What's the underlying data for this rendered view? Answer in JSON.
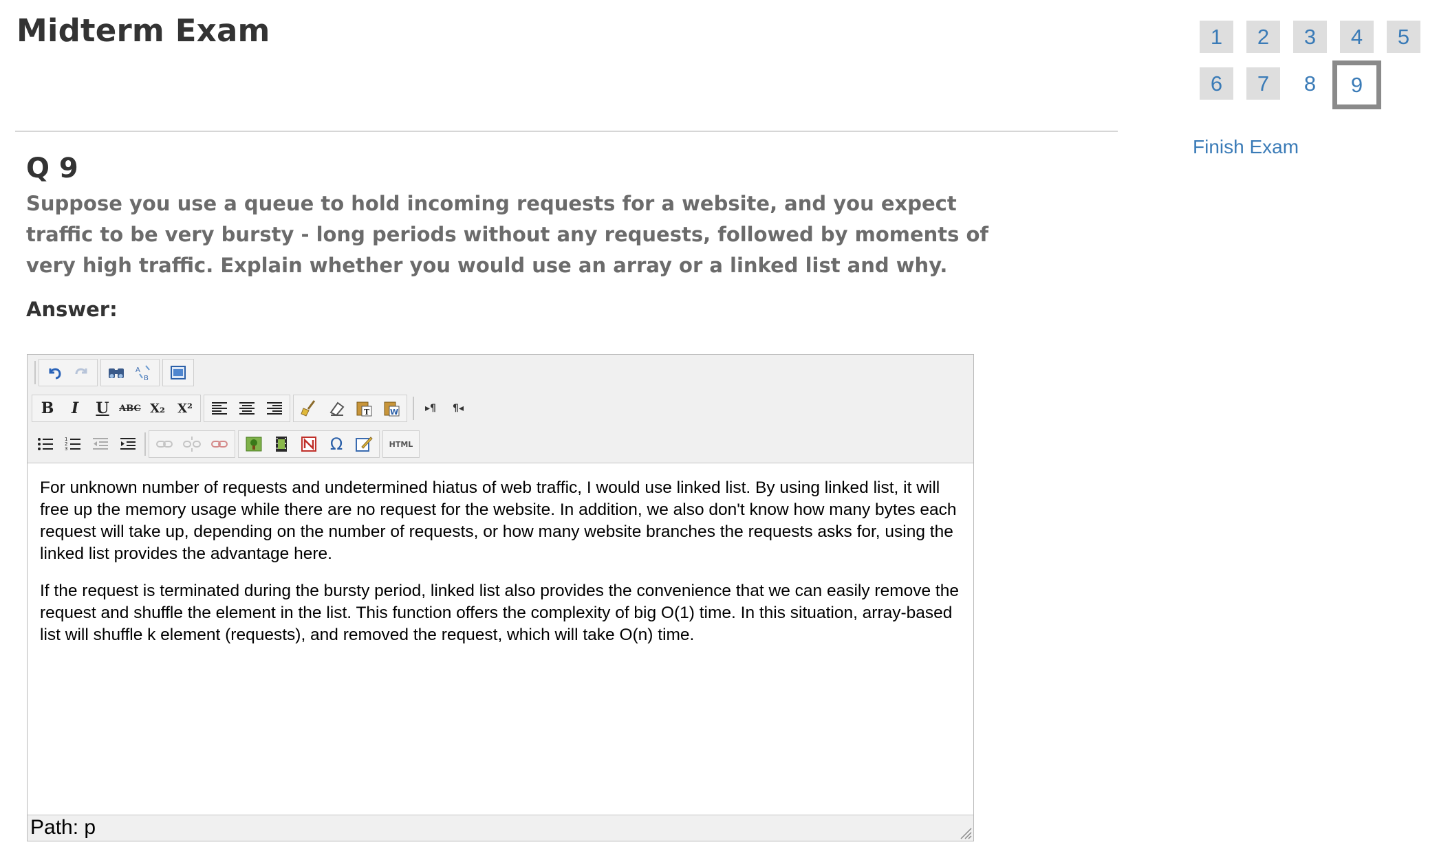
{
  "exam": {
    "title": "Midterm Exam"
  },
  "nav": {
    "questions": [
      "1",
      "2",
      "3",
      "4",
      "5",
      "6",
      "7",
      "8",
      "9"
    ],
    "current": "9",
    "finish_label": "Finish Exam"
  },
  "question": {
    "label": "Q 9",
    "text": "Suppose you use a queue to hold incoming requests for a website, and you expect traffic to be very bursty - long periods without any requests, followed by moments of very high traffic. Explain whether you would use an array or a linked list and why."
  },
  "answer": {
    "label": "Answer:",
    "paragraphs": [
      "For unknown number of requests and undetermined hiatus of web traffic, I would use linked list. By using linked list, it will free up the memory usage while there are no request for the website. In addition, we also don't know how many bytes each request will take up, depending on the number of requests, or how many website branches the requests asks for, using the linked list provides the advantage here.",
      "If the request is terminated during the bursty period, linked list also provides the convenience that we can easily remove the request and shuffle the element in the list. This function offers the complexity of big O(1) time. In this situation, array-based list will shuffle k element (requests), and removed the request, which will take O(n) time."
    ],
    "path": "Path: p"
  },
  "toolbar": {
    "bold": "B",
    "italic": "I",
    "underline": "U",
    "strike": "ABC",
    "subscript": "X₂",
    "superscript": "X²",
    "omega": "Ω",
    "html": "HTML",
    "ltr": "▸¶",
    "rtl": "¶◂"
  },
  "colors": {
    "link": "#3a7bb7",
    "nav_bg": "#dedede",
    "current_border": "#8a8a8a"
  }
}
